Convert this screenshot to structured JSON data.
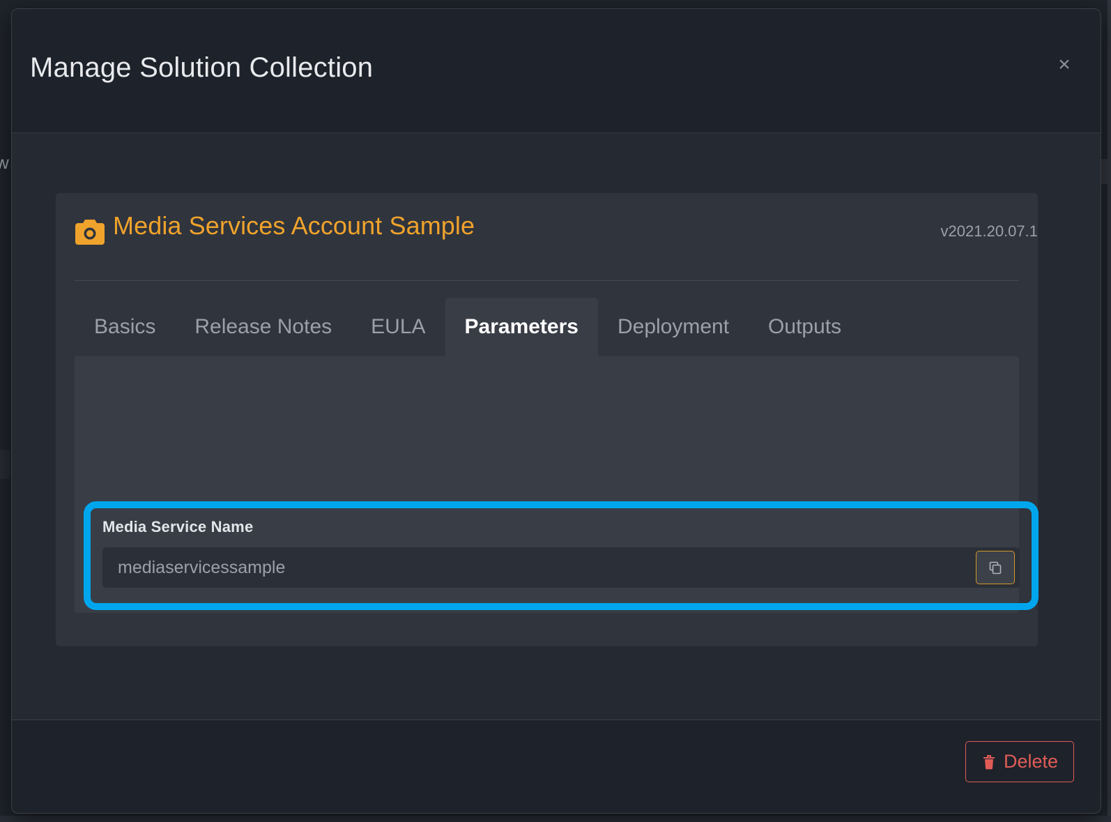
{
  "modal": {
    "title": "Manage Solution Collection",
    "close_label": "×",
    "close_icon": "close-icon"
  },
  "behind": {
    "left_text_fragment": "w"
  },
  "solution": {
    "icon": "camera-icon",
    "name": "Media Services Account Sample",
    "version": "v2021.20.07.1",
    "accent_color": "#f0a32c"
  },
  "tabs": [
    {
      "label": "Basics",
      "active": false
    },
    {
      "label": "Release Notes",
      "active": false
    },
    {
      "label": "EULA",
      "active": false
    },
    {
      "label": "Parameters",
      "active": true
    },
    {
      "label": "Deployment",
      "active": false
    },
    {
      "label": "Outputs",
      "active": false
    }
  ],
  "parameters": {
    "highlight_color": "#00a6ed",
    "field": {
      "label": "Media Service Name",
      "value": "",
      "placeholder": "mediaservicessample",
      "copy_icon": "copy-icon",
      "copy_border_color": "#d49a2b"
    }
  },
  "footer": {
    "delete_label": "Delete",
    "delete_icon": "trash-icon",
    "delete_color": "#e05c57"
  }
}
